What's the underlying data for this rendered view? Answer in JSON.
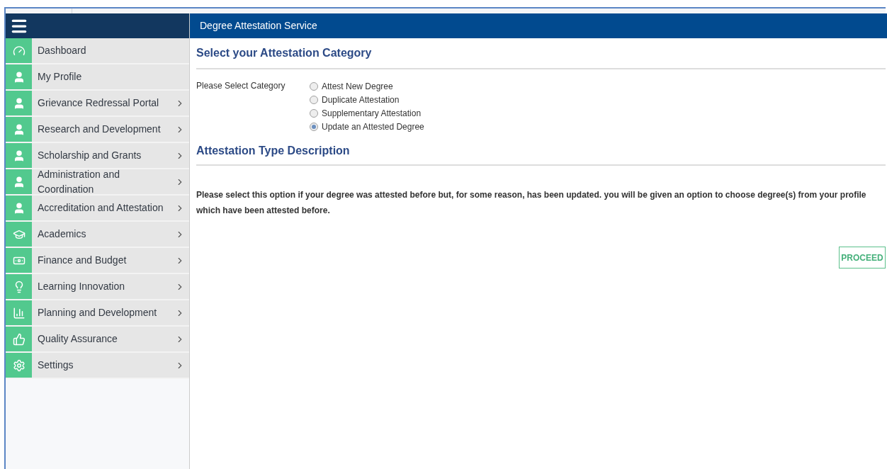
{
  "header": {
    "title": "Degree Attestation Service"
  },
  "sidebar": {
    "items": [
      {
        "label": "Dashboard",
        "expandable": false
      },
      {
        "label": "My Profile",
        "expandable": false
      },
      {
        "label": "Grievance Redressal Portal",
        "expandable": true
      },
      {
        "label": "Research and Development",
        "expandable": true
      },
      {
        "label": "Scholarship and Grants",
        "expandable": true
      },
      {
        "label": "Administration and Coordination",
        "expandable": true
      },
      {
        "label": "Accreditation and Attestation",
        "expandable": true
      },
      {
        "label": "Academics",
        "expandable": true
      },
      {
        "label": "Finance and Budget",
        "expandable": true
      },
      {
        "label": "Learning Innovation",
        "expandable": true
      },
      {
        "label": "Planning and Development",
        "expandable": true
      },
      {
        "label": "Quality Assurance",
        "expandable": true
      },
      {
        "label": "Settings",
        "expandable": true
      }
    ]
  },
  "category_section": {
    "title": "Select your Attestation Category",
    "label": "Please Select Category",
    "options": [
      {
        "label": "Attest New Degree",
        "selected": false
      },
      {
        "label": "Duplicate Attestation",
        "selected": false
      },
      {
        "label": "Supplementary Attestation",
        "selected": false
      },
      {
        "label": "Update an Attested Degree",
        "selected": true
      }
    ]
  },
  "description_section": {
    "title": "Attestation Type Description",
    "text": "Please select this option if your degree was attested before but, for some reason, has been updated. you will be given an option to choose degree(s) from your profile which have been attested before."
  },
  "proceed_button": "PROCEED"
}
